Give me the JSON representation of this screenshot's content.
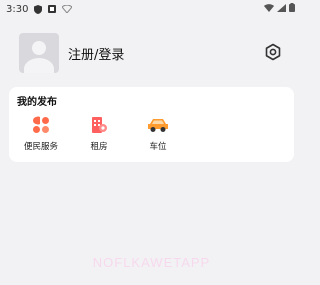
{
  "status_bar": {
    "time": "3:30",
    "icons": [
      "shield-icon",
      "notification-icon",
      "wifi-icon",
      "signal-icon",
      "battery-icon"
    ]
  },
  "profile": {
    "login_label": "注册/登录",
    "avatar_icon": "default-avatar-icon",
    "settings_icon": "settings-hexagon-icon"
  },
  "my_posts": {
    "title": "我的发布",
    "items": [
      {
        "label": "便民服务",
        "icon": "service-icon",
        "color": "#ff6b4a"
      },
      {
        "label": "租房",
        "icon": "rent-icon",
        "color": "#ff5f5f"
      },
      {
        "label": "车位",
        "icon": "parking-car-icon",
        "color": "#ff9b2f"
      }
    ]
  },
  "watermark": "NOFLKAWETAPP",
  "colors": {
    "background": "#f2f2f4",
    "card": "#ffffff",
    "watermark": "#f7d9ee"
  }
}
